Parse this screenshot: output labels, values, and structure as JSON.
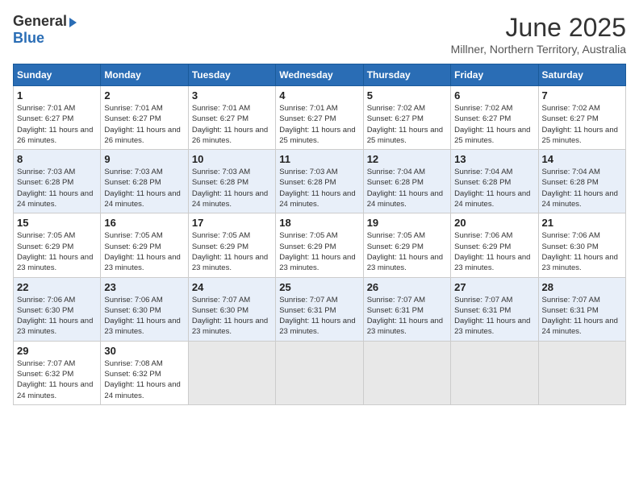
{
  "header": {
    "logo_general": "General",
    "logo_blue": "Blue",
    "month_title": "June 2025",
    "location": "Millner, Northern Territory, Australia"
  },
  "calendar": {
    "days_of_week": [
      "Sunday",
      "Monday",
      "Tuesday",
      "Wednesday",
      "Thursday",
      "Friday",
      "Saturday"
    ],
    "weeks": [
      [
        null,
        {
          "day": "2",
          "sunrise": "Sunrise: 7:01 AM",
          "sunset": "Sunset: 6:27 PM",
          "daylight": "Daylight: 11 hours and 26 minutes."
        },
        {
          "day": "3",
          "sunrise": "Sunrise: 7:01 AM",
          "sunset": "Sunset: 6:27 PM",
          "daylight": "Daylight: 11 hours and 26 minutes."
        },
        {
          "day": "4",
          "sunrise": "Sunrise: 7:01 AM",
          "sunset": "Sunset: 6:27 PM",
          "daylight": "Daylight: 11 hours and 25 minutes."
        },
        {
          "day": "5",
          "sunrise": "Sunrise: 7:02 AM",
          "sunset": "Sunset: 6:27 PM",
          "daylight": "Daylight: 11 hours and 25 minutes."
        },
        {
          "day": "6",
          "sunrise": "Sunrise: 7:02 AM",
          "sunset": "Sunset: 6:27 PM",
          "daylight": "Daylight: 11 hours and 25 minutes."
        },
        {
          "day": "7",
          "sunrise": "Sunrise: 7:02 AM",
          "sunset": "Sunset: 6:27 PM",
          "daylight": "Daylight: 11 hours and 25 minutes."
        }
      ],
      [
        {
          "day": "8",
          "sunrise": "Sunrise: 7:03 AM",
          "sunset": "Sunset: 6:28 PM",
          "daylight": "Daylight: 11 hours and 24 minutes."
        },
        {
          "day": "9",
          "sunrise": "Sunrise: 7:03 AM",
          "sunset": "Sunset: 6:28 PM",
          "daylight": "Daylight: 11 hours and 24 minutes."
        },
        {
          "day": "10",
          "sunrise": "Sunrise: 7:03 AM",
          "sunset": "Sunset: 6:28 PM",
          "daylight": "Daylight: 11 hours and 24 minutes."
        },
        {
          "day": "11",
          "sunrise": "Sunrise: 7:03 AM",
          "sunset": "Sunset: 6:28 PM",
          "daylight": "Daylight: 11 hours and 24 minutes."
        },
        {
          "day": "12",
          "sunrise": "Sunrise: 7:04 AM",
          "sunset": "Sunset: 6:28 PM",
          "daylight": "Daylight: 11 hours and 24 minutes."
        },
        {
          "day": "13",
          "sunrise": "Sunrise: 7:04 AM",
          "sunset": "Sunset: 6:28 PM",
          "daylight": "Daylight: 11 hours and 24 minutes."
        },
        {
          "day": "14",
          "sunrise": "Sunrise: 7:04 AM",
          "sunset": "Sunset: 6:28 PM",
          "daylight": "Daylight: 11 hours and 24 minutes."
        }
      ],
      [
        {
          "day": "15",
          "sunrise": "Sunrise: 7:05 AM",
          "sunset": "Sunset: 6:29 PM",
          "daylight": "Daylight: 11 hours and 23 minutes."
        },
        {
          "day": "16",
          "sunrise": "Sunrise: 7:05 AM",
          "sunset": "Sunset: 6:29 PM",
          "daylight": "Daylight: 11 hours and 23 minutes."
        },
        {
          "day": "17",
          "sunrise": "Sunrise: 7:05 AM",
          "sunset": "Sunset: 6:29 PM",
          "daylight": "Daylight: 11 hours and 23 minutes."
        },
        {
          "day": "18",
          "sunrise": "Sunrise: 7:05 AM",
          "sunset": "Sunset: 6:29 PM",
          "daylight": "Daylight: 11 hours and 23 minutes."
        },
        {
          "day": "19",
          "sunrise": "Sunrise: 7:05 AM",
          "sunset": "Sunset: 6:29 PM",
          "daylight": "Daylight: 11 hours and 23 minutes."
        },
        {
          "day": "20",
          "sunrise": "Sunrise: 7:06 AM",
          "sunset": "Sunset: 6:29 PM",
          "daylight": "Daylight: 11 hours and 23 minutes."
        },
        {
          "day": "21",
          "sunrise": "Sunrise: 7:06 AM",
          "sunset": "Sunset: 6:30 PM",
          "daylight": "Daylight: 11 hours and 23 minutes."
        }
      ],
      [
        {
          "day": "22",
          "sunrise": "Sunrise: 7:06 AM",
          "sunset": "Sunset: 6:30 PM",
          "daylight": "Daylight: 11 hours and 23 minutes."
        },
        {
          "day": "23",
          "sunrise": "Sunrise: 7:06 AM",
          "sunset": "Sunset: 6:30 PM",
          "daylight": "Daylight: 11 hours and 23 minutes."
        },
        {
          "day": "24",
          "sunrise": "Sunrise: 7:07 AM",
          "sunset": "Sunset: 6:30 PM",
          "daylight": "Daylight: 11 hours and 23 minutes."
        },
        {
          "day": "25",
          "sunrise": "Sunrise: 7:07 AM",
          "sunset": "Sunset: 6:31 PM",
          "daylight": "Daylight: 11 hours and 23 minutes."
        },
        {
          "day": "26",
          "sunrise": "Sunrise: 7:07 AM",
          "sunset": "Sunset: 6:31 PM",
          "daylight": "Daylight: 11 hours and 23 minutes."
        },
        {
          "day": "27",
          "sunrise": "Sunrise: 7:07 AM",
          "sunset": "Sunset: 6:31 PM",
          "daylight": "Daylight: 11 hours and 23 minutes."
        },
        {
          "day": "28",
          "sunrise": "Sunrise: 7:07 AM",
          "sunset": "Sunset: 6:31 PM",
          "daylight": "Daylight: 11 hours and 24 minutes."
        }
      ],
      [
        {
          "day": "29",
          "sunrise": "Sunrise: 7:07 AM",
          "sunset": "Sunset: 6:32 PM",
          "daylight": "Daylight: 11 hours and 24 minutes."
        },
        {
          "day": "30",
          "sunrise": "Sunrise: 7:08 AM",
          "sunset": "Sunset: 6:32 PM",
          "daylight": "Daylight: 11 hours and 24 minutes."
        },
        null,
        null,
        null,
        null,
        null
      ]
    ],
    "week1_day1": {
      "day": "1",
      "sunrise": "Sunrise: 7:01 AM",
      "sunset": "Sunset: 6:27 PM",
      "daylight": "Daylight: 11 hours and 26 minutes."
    }
  }
}
